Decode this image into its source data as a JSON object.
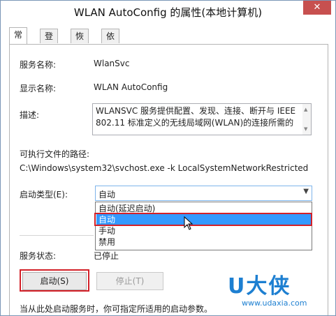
{
  "window": {
    "title": "WLAN AutoConfig 的属性(本地计算机)",
    "close_glyph": "✕"
  },
  "tabs": [
    {
      "label": "常规"
    },
    {
      "label": "登录"
    },
    {
      "label": "恢复"
    },
    {
      "label": "依存关系"
    }
  ],
  "general": {
    "service_name_label": "服务名称:",
    "service_name": "WlanSvc",
    "display_name_label": "显示名称:",
    "display_name": "WLAN AutoConfig",
    "description_label": "描述:",
    "description": "WLANSVC 服务提供配置、发现、连接、断开与 IEEE\n802.11 标准定义的无线局域网(WLAN)的连接所需的",
    "path_label": "可执行文件的路径:",
    "path": "C:\\Windows\\system32\\svchost.exe -k LocalSystemNetworkRestricted",
    "startup_type_label": "启动类型(E):",
    "startup_type_value": "自动",
    "startup_options": [
      "自动(延迟启动)",
      "自动",
      "手动",
      "禁用"
    ],
    "highlighted_option": "自动",
    "status_label": "服务状态:",
    "status_value": "已停止",
    "start_button": "启动(S)",
    "stop_button": "停止(T)",
    "hint": "当从此处启动服务时，你可指定所适用的启动参数。"
  },
  "watermark": {
    "logo": "U大侠",
    "url": "www.udaxia.com"
  },
  "colors": {
    "highlight": "#3399ff",
    "annotation_red": "#d32028",
    "watermark_blue": "#1d7fd1"
  }
}
